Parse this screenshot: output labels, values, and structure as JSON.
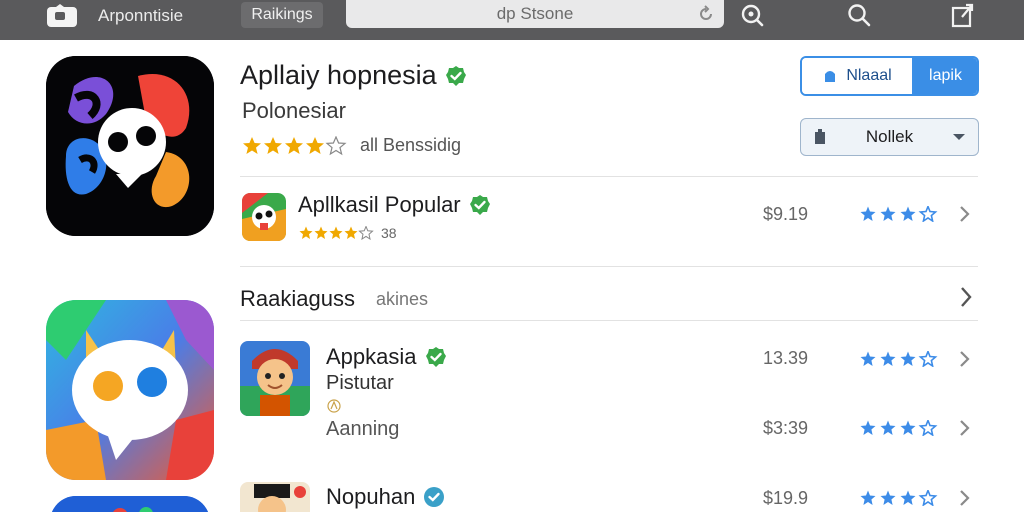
{
  "topbar": {
    "app_name": "Arponntisie",
    "tab_label": "Raikings",
    "search_text": "dp Stsone",
    "icons": [
      "app-logo-icon",
      "reload-icon",
      "search-circle-icon",
      "search-icon",
      "share-icon"
    ]
  },
  "featured": {
    "title": "Apllaiy hopnesia",
    "subtitle": "Polonesiar",
    "rating_caption": "all Benssidig",
    "rating_stars": 4.5,
    "verified": true
  },
  "actions": {
    "primary_label": "Nlaaal",
    "secondary_label": "lapik",
    "dropdown_label": "Nollek"
  },
  "list_top": [
    {
      "title": "Apllkasil Popular",
      "rating_count": "38",
      "rating_stars": 4.5,
      "price": "$9.19",
      "verified": true
    }
  ],
  "section": {
    "title": "Raakiaguss",
    "subtitle": "akines"
  },
  "list_section": [
    {
      "title": "Appkasia",
      "subtitle": "Pistutar",
      "verified": true,
      "price": "13.39"
    },
    {
      "title": "",
      "subtitle": "Aanning",
      "verified": false,
      "price": "$3:39"
    },
    {
      "title": "Nopuhan",
      "subtitle": "",
      "verified": true,
      "price": "$19.9"
    }
  ],
  "colors": {
    "topbar_bg": "#5a5a5c",
    "accent_blue": "#3a8ee6",
    "verified_green": "#3aa94a",
    "star_gold": "#f0a800",
    "star_blue": "#3d8ce8"
  }
}
